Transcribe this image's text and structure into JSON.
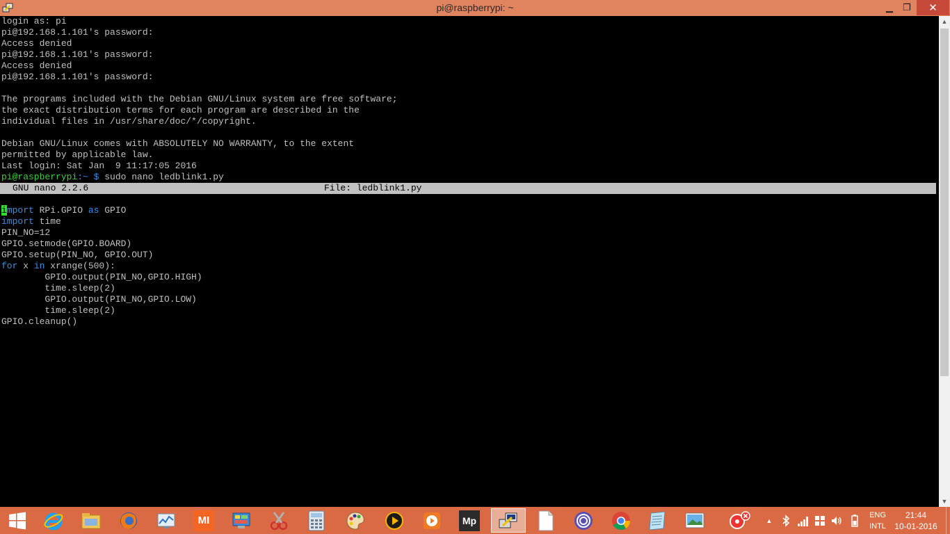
{
  "window": {
    "title": "pi@raspberrypi: ~",
    "minimize_glyph": "▁",
    "maximize_glyph": "❐",
    "close_glyph": "✕",
    "titlebar_color": "#e0845f",
    "close_color": "#c7493a"
  },
  "terminal": {
    "session_lines": [
      "login as: pi",
      "pi@192.168.1.101's password:",
      "Access denied",
      "pi@192.168.1.101's password:",
      "Access denied",
      "pi@192.168.1.101's password:",
      "",
      "The programs included with the Debian GNU/Linux system are free software;",
      "the exact distribution terms for each program are described in the",
      "individual files in /usr/share/doc/*/copyright.",
      "",
      "Debian GNU/Linux comes with ABSOLUTELY NO WARRANTY, to the extent",
      "permitted by applicable law.",
      "Last login: Sat Jan  9 11:17:05 2016"
    ],
    "prompt": {
      "user_host": "pi@raspberrypi",
      "path": ":~ $ ",
      "command": "sudo nano ledblink1.py"
    },
    "nano": {
      "version": "GNU nano 2.2.6",
      "file": "File: ledblink1.py"
    },
    "code": {
      "line1_cursor": "i",
      "line1_kw": "mport",
      "line1_rest": " RPi.GPIO ",
      "line1_as": "as",
      "line1_tail": " GPIO",
      "line2_kw": "import",
      "line2_rest": " time",
      "line3": "PIN_NO=12",
      "line4": "GPIO.setmode(GPIO.BOARD)",
      "line5": "GPIO.setup(PIN_NO, GPIO.OUT)",
      "line6_for": "for",
      "line6_mid": " x ",
      "line6_in": "in",
      "line6_rest": " xrange(500):",
      "line7": "        GPIO.output(PIN_NO,GPIO.HIGH)",
      "line8": "        time.sleep(2)",
      "line9": "        GPIO.output(PIN_NO,GPIO.LOW)",
      "line10": "        time.sleep(2)",
      "line11": "GPIO.cleanup()"
    },
    "colors": {
      "text": "#c0c0c0",
      "keyword": "#3a8ee6",
      "prompt_user": "#3fcf3f",
      "cursor": "#33e033"
    }
  },
  "scrollbar": {
    "up_glyph": "▲",
    "down_glyph": "▼"
  },
  "taskbar": {
    "color": "#d96a44",
    "apps": [
      {
        "name": "windows-start-icon"
      },
      {
        "name": "internet-explorer-icon"
      },
      {
        "name": "file-explorer-icon"
      },
      {
        "name": "firefox-icon"
      },
      {
        "name": "resource-monitor-icon"
      },
      {
        "name": "mi-icon"
      },
      {
        "name": "control-panel-icon"
      },
      {
        "name": "snipping-tool-icon"
      },
      {
        "name": "calculator-icon"
      },
      {
        "name": "paint-icon"
      },
      {
        "name": "media-player-icon"
      },
      {
        "name": "video-player-icon"
      },
      {
        "name": "mp-icon"
      },
      {
        "name": "putty-icon"
      },
      {
        "name": "document-icon"
      },
      {
        "name": "bittorrent-icon"
      },
      {
        "name": "chrome-icon"
      },
      {
        "name": "notepad-icon"
      },
      {
        "name": "photos-icon"
      },
      {
        "name": "tools-icon"
      }
    ],
    "mi_label": "MI",
    "mp_label": "Mp",
    "tray": {
      "overflow_glyph": "▲",
      "lang_line1": "ENG",
      "lang_line2": "INTL",
      "time": "21:44",
      "date": "10-01-2016"
    }
  }
}
